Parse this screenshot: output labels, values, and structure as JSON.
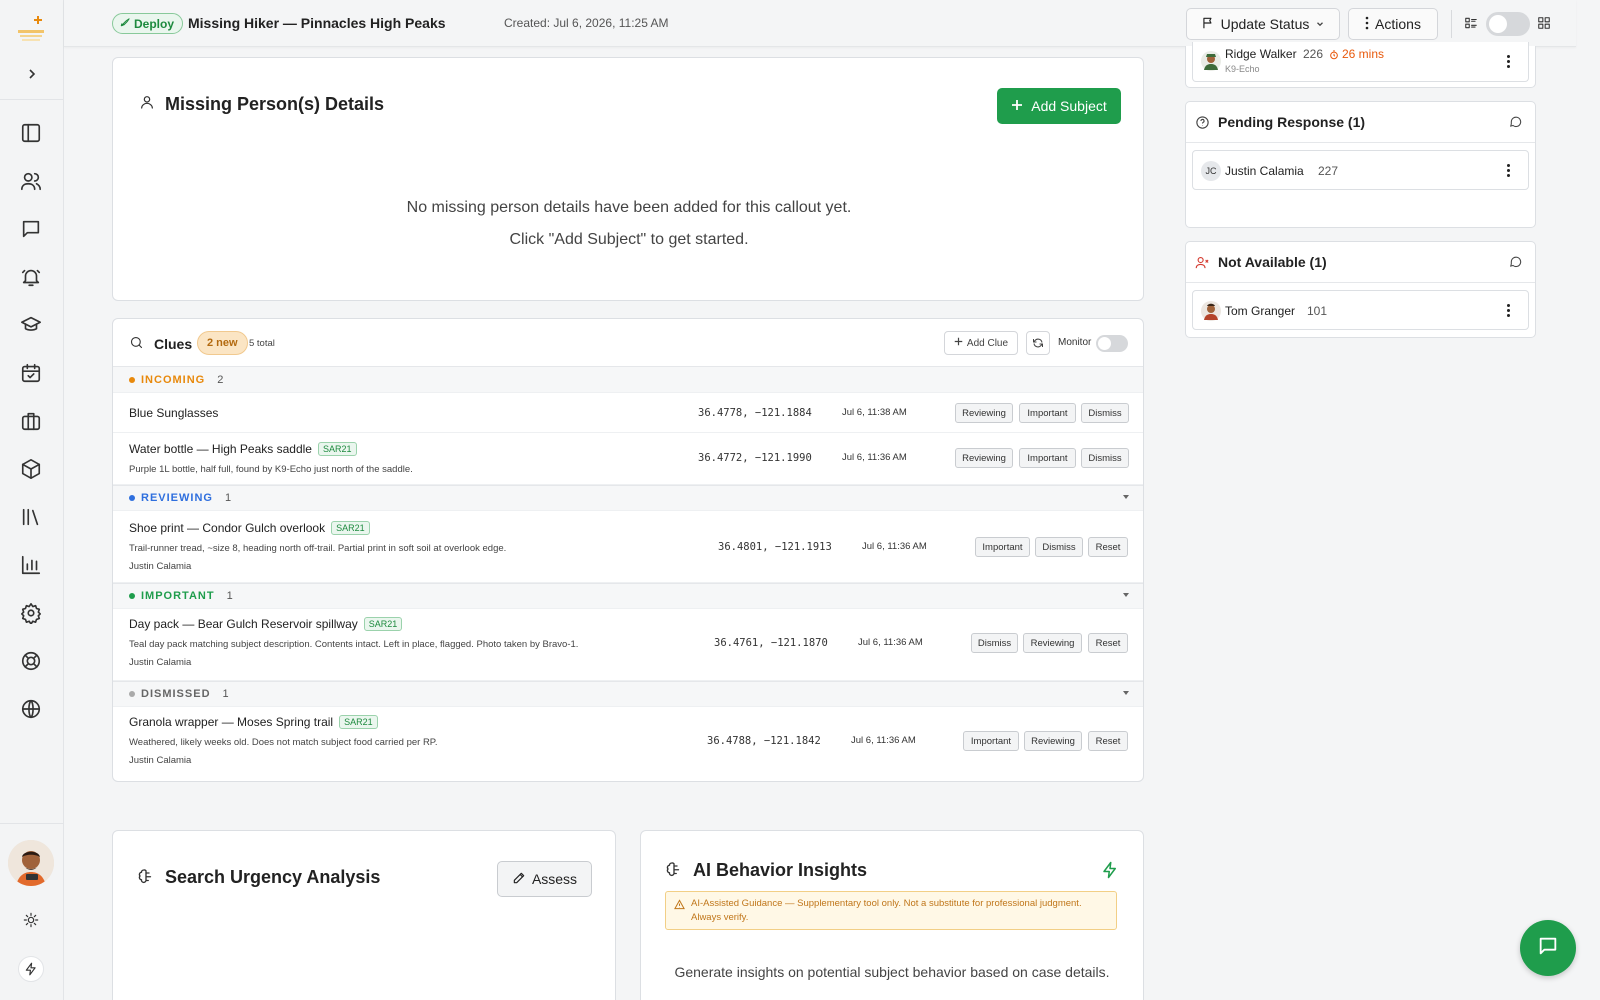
{
  "app": {
    "title": "Missing Hiker — Pinnacles High Peaks",
    "created": "Created: Jul 6, 2026, 11:25 AM",
    "deploy_label": "Deploy"
  },
  "colors": {
    "accent": "#1f9d4c",
    "incoming": "#e8890c",
    "reviewing": "#2f6fde",
    "important": "#1f9d4c",
    "dismissed": "#aaaaaa"
  },
  "sidebar": {
    "icons": [
      "panel-icon",
      "users-icon",
      "chat-icon",
      "bell-icon",
      "graduation-icon",
      "calendar-check-icon",
      "briefcase-icon",
      "package-icon",
      "library-icon",
      "bar-chart-icon",
      "settings-icon",
      "lifebuoy-icon",
      "globe-icon"
    ]
  },
  "toolbar": {
    "update_status": "Update Status",
    "actions": "Actions"
  },
  "missing": {
    "title": "Missing Person(s) Details",
    "add_label": "Add Subject",
    "empty_line1": "No missing person details have been added for this callout yet.",
    "empty_line2": "Click \"Add Subject\" to get started."
  },
  "clues": {
    "title": "Clues",
    "new_badge": "2 new",
    "total": "5 total",
    "add_label": "Add Clue",
    "monitor_label": "Monitor",
    "sections": [
      {
        "label": "INCOMING",
        "count": "2",
        "items": [
          {
            "title": "Blue Sunglasses",
            "tag": "",
            "desc": "",
            "who": "",
            "coord": "36.4778, −121.1884",
            "time": "Jul 6, 11:38 AM",
            "actions": [
              "Reviewing",
              "Important",
              "Dismiss"
            ]
          },
          {
            "title": "Water bottle — High Peaks saddle",
            "tag": "SAR21",
            "desc": "Purple 1L bottle, half full, found by K9-Echo just north of the saddle.",
            "who": "",
            "coord": "36.4772, −121.1990",
            "time": "Jul 6, 11:36 AM",
            "actions": [
              "Reviewing",
              "Important",
              "Dismiss"
            ]
          }
        ]
      },
      {
        "label": "REVIEWING",
        "count": "1",
        "items": [
          {
            "title": "Shoe print — Condor Gulch overlook",
            "tag": "SAR21",
            "desc": "Trail-runner tread, ~size 8, heading north off-trail. Partial print in soft soil at overlook edge.",
            "who": "Justin Calamia",
            "coord": "36.4801, −121.1913",
            "time": "Jul 6, 11:36 AM",
            "actions": [
              "Important",
              "Dismiss",
              "Reset"
            ]
          }
        ]
      },
      {
        "label": "IMPORTANT",
        "count": "1",
        "items": [
          {
            "title": "Day pack — Bear Gulch Reservoir spillway",
            "tag": "SAR21",
            "desc": "Teal day pack matching subject description. Contents intact. Left in place, flagged. Photo taken by Bravo-1.",
            "who": "Justin Calamia",
            "coord": "36.4761, −121.1870",
            "time": "Jul 6, 11:36 AM",
            "actions": [
              "Dismiss",
              "Reviewing",
              "Reset"
            ]
          }
        ]
      },
      {
        "label": "DISMISSED",
        "count": "1",
        "items": [
          {
            "title": "Granola wrapper — Moses Spring trail",
            "tag": "SAR21",
            "desc": "Weathered, likely weeks old. Does not match subject food carried per RP.",
            "who": "Justin Calamia",
            "coord": "36.4788, −121.1842",
            "time": "Jul 6, 11:36 AM",
            "actions": [
              "Important",
              "Reviewing",
              "Reset"
            ]
          }
        ]
      }
    ]
  },
  "urgency": {
    "title": "Search Urgency Analysis",
    "assess_label": "Assess"
  },
  "ai": {
    "title": "AI Behavior Insights",
    "warning": "AI-Assisted Guidance — Supplementary tool only. Not a substitute for professional judgment. Always verify.",
    "body": "Generate insights on potential subject behavior based on case details."
  },
  "right_panel": {
    "top_person": {
      "name": "Ridge Walker",
      "num": "226",
      "sub": "K9-Echo",
      "eta": "26 mins"
    },
    "pending": {
      "title": "Pending Response (1)",
      "person": {
        "initials": "JC",
        "name": "Justin Calamia",
        "num": "227"
      }
    },
    "not_available": {
      "title": "Not Available (1)",
      "person": {
        "name": "Tom Granger",
        "num": "101"
      }
    }
  }
}
